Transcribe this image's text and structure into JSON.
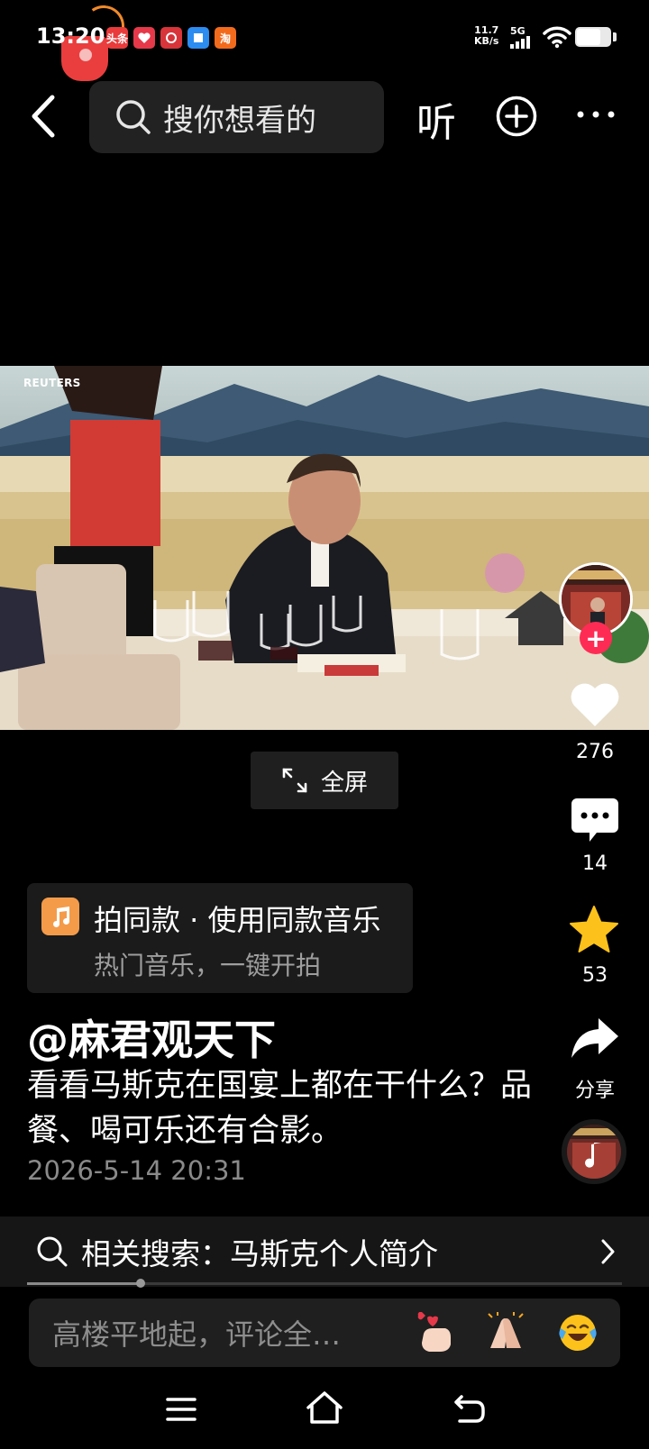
{
  "status_bar": {
    "time": "13:20",
    "net_speed_value": "11.7",
    "net_speed_unit": "KB/s",
    "network": "5G",
    "notification_apps": [
      {
        "icon": "toutiao-icon",
        "label": "头条",
        "color": "#e93b3b"
      },
      {
        "icon": "heart-app-icon",
        "label": "",
        "color": "#e5394a"
      },
      {
        "icon": "red-app-icon",
        "label": "",
        "color": "#d7353a"
      },
      {
        "icon": "blue-app-icon",
        "label": "",
        "color": "#2d8cf0"
      },
      {
        "icon": "taobao-icon",
        "label": "淘",
        "color": "#f26b1d"
      }
    ]
  },
  "top_nav": {
    "search_placeholder": "搜你想看的",
    "listen_label": "听"
  },
  "video": {
    "watermark": "REUTERS",
    "fullscreen_label": "全屏"
  },
  "right_rail": {
    "likes": "276",
    "comments": "14",
    "favorites": "53",
    "share_label": "分享"
  },
  "music_card": {
    "title": "拍同款 · 使用同款音乐",
    "subtitle": "热门音乐，一键开拍"
  },
  "post": {
    "author": "@麻君观天下",
    "caption": "看看马斯克在国宴上都在干什么？品餐、喝可乐还有合影。",
    "date": "2026-5-14 20:31"
  },
  "related_search": {
    "label": "相关搜索：马斯克个人简介"
  },
  "playback": {
    "progress_fraction": 0.19
  },
  "comment_bar": {
    "placeholder": "高楼平地起，评论全…",
    "emojis": [
      "heart-hand-emoji",
      "clap-emoji",
      "laugh-cry-emoji"
    ]
  },
  "colors": {
    "accent_red": "#fe2c55",
    "favorite_yellow": "#fcc21b",
    "music_orange": "#f49b4a"
  }
}
